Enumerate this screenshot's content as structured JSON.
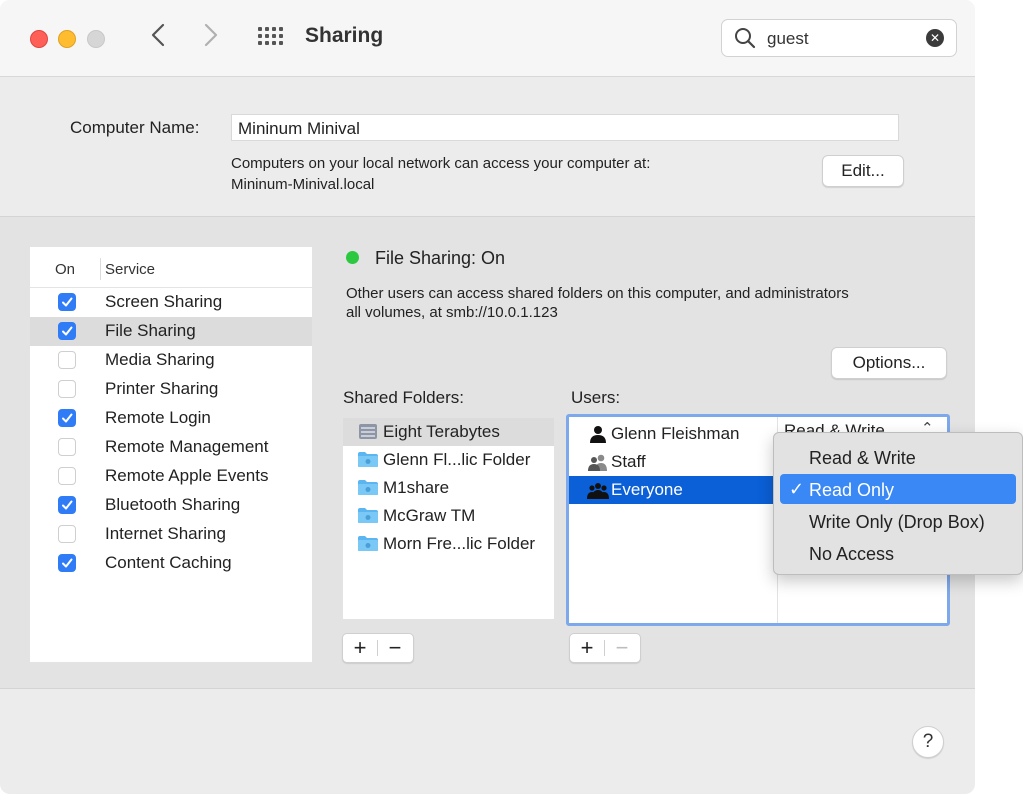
{
  "window": {
    "title": "Sharing",
    "search": {
      "value": "guest"
    }
  },
  "computer": {
    "label": "Computer Name:",
    "name": "Mininum Minival",
    "note_line1": "Computers on your local network can access your computer at:",
    "note_line2": "Mininum-Minival.local",
    "edit_label": "Edit..."
  },
  "services": {
    "header_on": "On",
    "header_service": "Service",
    "items": [
      {
        "label": "Screen Sharing",
        "checked": true
      },
      {
        "label": "File Sharing",
        "checked": true,
        "selected": true
      },
      {
        "label": "Media Sharing",
        "checked": false
      },
      {
        "label": "Printer Sharing",
        "checked": false
      },
      {
        "label": "Remote Login",
        "checked": true
      },
      {
        "label": "Remote Management",
        "checked": false
      },
      {
        "label": "Remote Apple Events",
        "checked": false
      },
      {
        "label": "Bluetooth Sharing",
        "checked": true
      },
      {
        "label": "Internet Sharing",
        "checked": false
      },
      {
        "label": "Content Caching",
        "checked": true
      }
    ]
  },
  "file_sharing": {
    "status": "File Sharing: On",
    "status_color": "#2bc840",
    "desc_line1": "Other users can access shared folders on this computer, and administrators",
    "desc_line2": "all volumes, at smb://10.0.1.123",
    "options_label": "Options..."
  },
  "shared_folders": {
    "label": "Shared Folders:",
    "items": [
      {
        "label": "Eight Terabytes",
        "icon": "drive-icon"
      },
      {
        "label": "Glenn Fl...lic Folder",
        "icon": "folder-icon"
      },
      {
        "label": "M1share",
        "icon": "folder-icon"
      },
      {
        "label": "McGraw TM",
        "icon": "folder-icon"
      },
      {
        "label": "Morn Fre...lic Folder",
        "icon": "folder-icon"
      }
    ],
    "plus": "+",
    "minus": "−"
  },
  "users": {
    "label": "Users:",
    "items": [
      {
        "name": "Glenn Fleishman",
        "icon": "user-icon"
      },
      {
        "name": "Staff",
        "icon": "group-icon"
      },
      {
        "name": "Everyone",
        "icon": "everyone-icon"
      }
    ],
    "first_permission": "Read & Write",
    "plus": "+",
    "minus": "−"
  },
  "permission_menu": {
    "items": [
      "Read & Write",
      "Read Only",
      "Write Only (Drop Box)",
      "No Access"
    ],
    "selected": "Read Only",
    "checkmark": "✓"
  },
  "help": {
    "label": "?"
  },
  "colors": {
    "accent": "#2f7cf6",
    "selection": "#0b5fd7",
    "menu_highlight": "#3a88f5"
  }
}
